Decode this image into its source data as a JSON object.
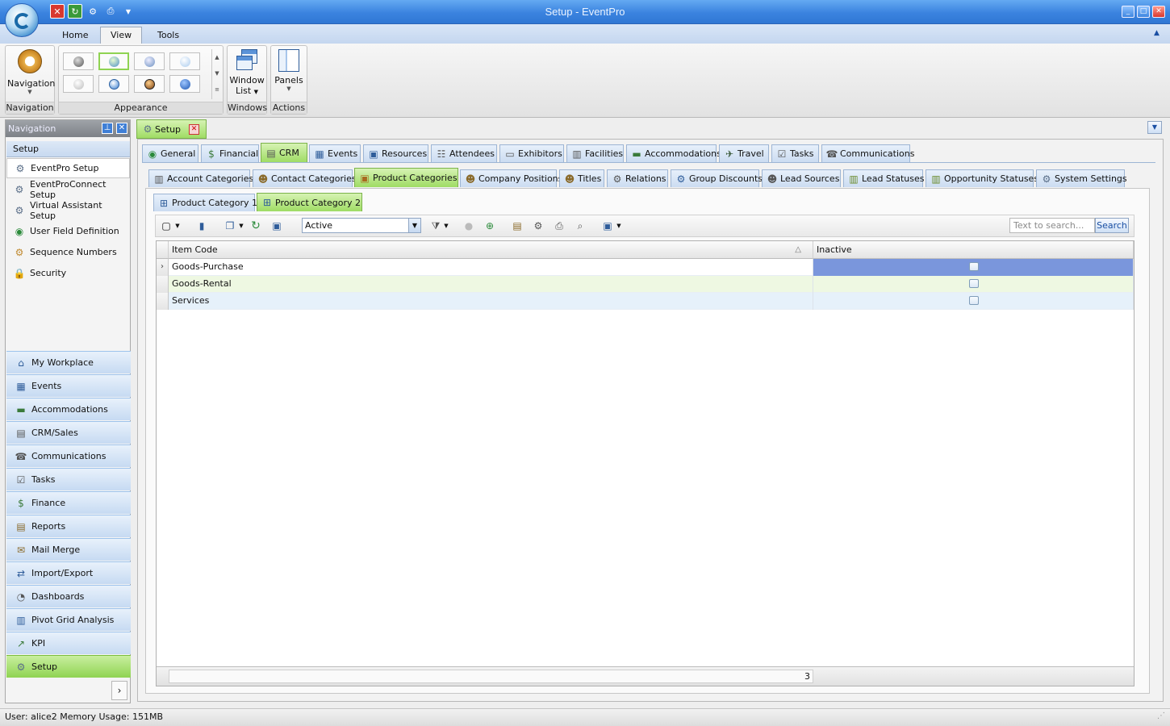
{
  "window": {
    "title": "Setup - EventPro"
  },
  "menu": {
    "tabs": [
      "Home",
      "View",
      "Tools"
    ],
    "active": "View"
  },
  "ribbon": {
    "navigation": {
      "button": "Navigation",
      "group": "Navigation"
    },
    "appearance": {
      "group": "Appearance"
    },
    "windows": {
      "button_line1": "Window",
      "button_line2": "List",
      "group": "Windows"
    },
    "actions": {
      "button": "Panels",
      "group": "Actions"
    }
  },
  "nav": {
    "header": "Navigation",
    "section": "Setup",
    "items": [
      {
        "label": "EventPro Setup",
        "icon": "gear-icon"
      },
      {
        "label": "EventProConnect Setup",
        "icon": "gear-icon"
      },
      {
        "label": "Virtual Assistant Setup",
        "icon": "gear-icon"
      },
      {
        "label": "User Field Definition",
        "icon": "eye-icon"
      },
      {
        "label": "Sequence Numbers",
        "icon": "gear-icon"
      },
      {
        "label": "Security",
        "icon": "lock-icon"
      }
    ],
    "modules": [
      {
        "label": "My Workplace",
        "icon": "house-icon"
      },
      {
        "label": "Events",
        "icon": "calendar-icon"
      },
      {
        "label": "Accommodations",
        "icon": "bed-icon"
      },
      {
        "label": "CRM/Sales",
        "icon": "crm-icon"
      },
      {
        "label": "Communications",
        "icon": "phone-icon"
      },
      {
        "label": "Tasks",
        "icon": "checklist-icon"
      },
      {
        "label": "Finance",
        "icon": "money-icon"
      },
      {
        "label": "Reports",
        "icon": "report-icon"
      },
      {
        "label": "Mail Merge",
        "icon": "mail-merge-icon"
      },
      {
        "label": "Import/Export",
        "icon": "import-export-icon"
      },
      {
        "label": "Dashboards",
        "icon": "dashboard-icon"
      },
      {
        "label": "Pivot Grid Analysis",
        "icon": "pivot-icon"
      },
      {
        "label": "KPI",
        "icon": "kpi-icon"
      },
      {
        "label": "Setup",
        "icon": "gear-icon"
      }
    ],
    "selected_module": "Setup"
  },
  "doc_tab": {
    "label": "Setup"
  },
  "main_tabs": [
    "General",
    "Financial",
    "CRM",
    "Events",
    "Resources",
    "Attendees",
    "Exhibitors",
    "Facilities",
    "Accommodations",
    "Travel",
    "Tasks",
    "Communications"
  ],
  "main_tab_active": "CRM",
  "crm_tabs": [
    "Account Categories",
    "Contact Categories",
    "Product Categories",
    "Company Positions",
    "Titles",
    "Relations",
    "Group Discounts",
    "Lead Sources",
    "Lead Statuses",
    "Opportunity Statuses",
    "System Settings"
  ],
  "crm_tab_active": "Product Categories",
  "sub_tabs": [
    "Product Category 1",
    "Product Category 2"
  ],
  "sub_tab_active": "Product Category 2",
  "toolbar": {
    "filter_value": "Active",
    "search_placeholder": "Text to search...",
    "search_button": "Search"
  },
  "grid": {
    "columns": [
      "Item Code",
      "Inactive"
    ],
    "rows": [
      {
        "item_code": "Goods-Purchase",
        "inactive": false
      },
      {
        "item_code": "Goods-Rental",
        "inactive": false
      },
      {
        "item_code": "Services",
        "inactive": false
      }
    ],
    "count": "3"
  },
  "status": {
    "text": "User: alice2  Memory Usage: 151MB"
  }
}
